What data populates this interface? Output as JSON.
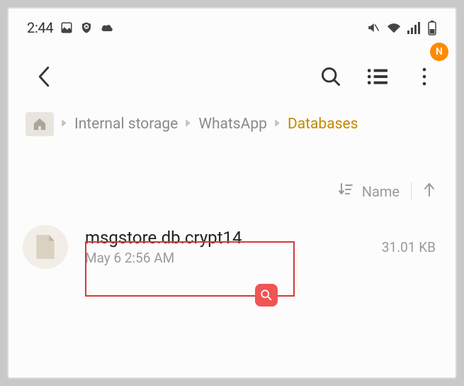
{
  "status": {
    "time": "2:44"
  },
  "header": {
    "badge": "N"
  },
  "breadcrumb": {
    "items": [
      "Internal storage",
      "WhatsApp",
      "Databases"
    ]
  },
  "sort": {
    "label": "Name"
  },
  "file": {
    "name": "msgstore.db.crypt14",
    "date": "May 6 2:56 AM",
    "size": "31.01 KB"
  }
}
